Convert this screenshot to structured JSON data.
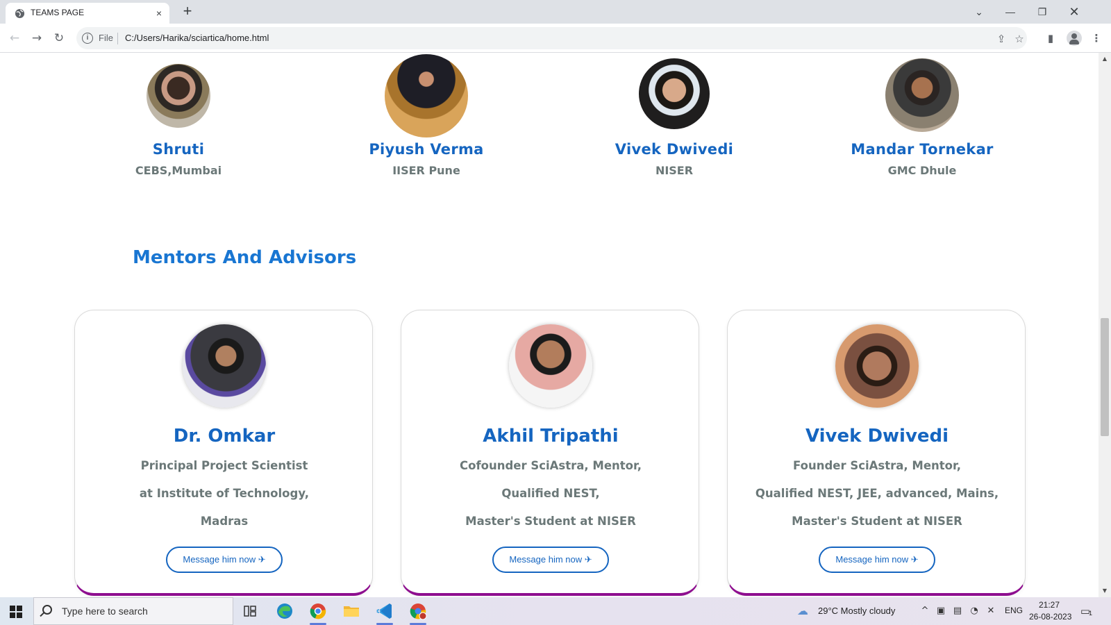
{
  "browser": {
    "tab_title": "TEAMS PAGE",
    "tab_close": "×",
    "new_tab": "+",
    "address_scheme": "File",
    "address_url": "C:/Users/Harika/sciartica/home.html"
  },
  "team_members": [
    {
      "name": "Shruti",
      "institution": "CEBS,Mumbai"
    },
    {
      "name": "Piyush Verma",
      "institution": "IISER Pune"
    },
    {
      "name": "Vivek Dwivedi",
      "institution": "NISER"
    },
    {
      "name": "Mandar Tornekar",
      "institution": "GMC Dhule"
    }
  ],
  "mentors_section": {
    "title": "Mentors And Advisors",
    "mentors": [
      {
        "name": "Dr. Omkar",
        "lines": [
          "Principal Project Scientist",
          "at Institute of Technology,",
          "Madras"
        ],
        "button": "Message him now ✈"
      },
      {
        "name": "Akhil Tripathi",
        "lines": [
          "Cofounder SciAstra, Mentor,",
          "Qualified NEST,",
          "Master's Student at NISER"
        ],
        "button": "Message him now ✈"
      },
      {
        "name": "Vivek Dwivedi",
        "lines": [
          "Founder SciAstra, Mentor,",
          "Qualified NEST, JEE, advanced, Mains,",
          "Master's Student at NISER"
        ],
        "button": "Message him now ✈"
      }
    ]
  },
  "taskbar": {
    "search_placeholder": "Type here to search",
    "weather": "29°C  Mostly cloudy",
    "language": "ENG",
    "time": "21:27",
    "date": "26-08-2023",
    "notification_count": "1"
  }
}
